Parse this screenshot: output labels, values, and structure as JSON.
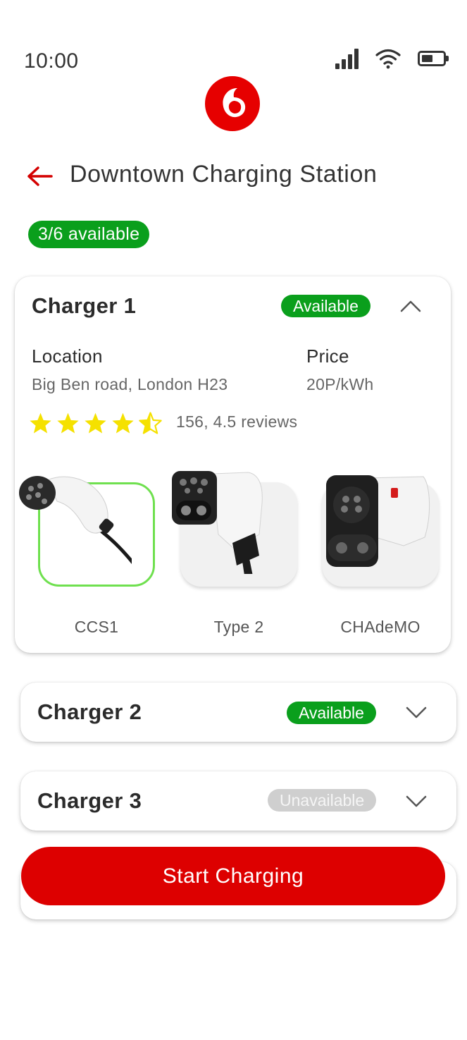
{
  "status_bar": {
    "time": "10:00",
    "battery_level": 0.55
  },
  "brand": {
    "logo_icon": "vodafone-logo-icon",
    "color": "#e60000"
  },
  "header": {
    "back_icon": "arrow-left-icon",
    "title": "Downtown Charging Station"
  },
  "availability": {
    "label": "3/6 available",
    "color": "#0a9f1c"
  },
  "chargers": [
    {
      "name": "Charger 1",
      "status": "Available",
      "expanded": true,
      "location_label": "Location",
      "location": "Big Ben road, London H23",
      "price_label": "Price",
      "price": "20P/kWh",
      "rating": 4.5,
      "reviews": "156, 4.5 reviews",
      "connectors": [
        {
          "label": "CCS1",
          "selected": true
        },
        {
          "label": "Type 2",
          "selected": false
        },
        {
          "label": "CHAdeMO",
          "selected": false
        }
      ]
    },
    {
      "name": "Charger 2",
      "status": "Available",
      "expanded": false
    },
    {
      "name": "Charger 3",
      "status": "Unavailable",
      "expanded": false
    }
  ],
  "actions": {
    "start_label": "Start Charging",
    "start_color": "#dd0000"
  }
}
